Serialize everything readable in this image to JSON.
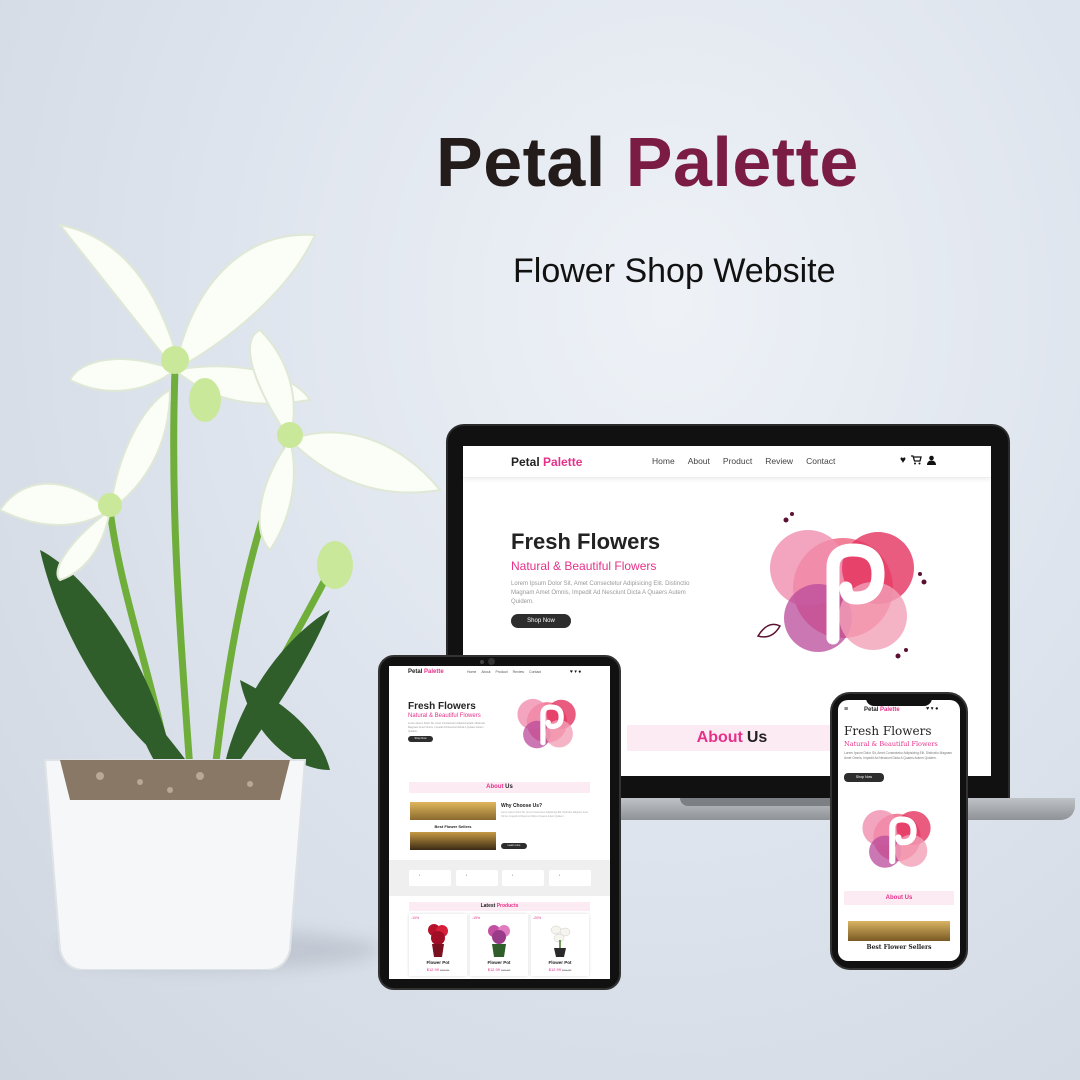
{
  "brand": {
    "name_part1": "Petal",
    "name_part2": "Palette",
    "tagline": "Flower Shop Website"
  },
  "colors": {
    "brand_dark": "#241c1b",
    "brand_accent": "#7a1c44",
    "site_pink": "#e5318a",
    "button_dark": "#2d2d2d"
  },
  "site": {
    "logo_part1": "Petal",
    "logo_part2": "Palette",
    "nav": [
      "Home",
      "About",
      "Product",
      "Review",
      "Contact"
    ],
    "nav_icons": [
      "heart-icon",
      "cart-icon",
      "user-icon"
    ],
    "hero_title": "Fresh Flowers",
    "hero_subtitle": "Natural & Beautiful Flowers",
    "hero_body": "Lorem Ipsum Dolor Sit, Amet Consectetur Adipisicing Elit. Distinctio Magnam Amet Omnis, Impedit Ad Nesciunt Dicta A Quaers Autem Quidem.",
    "cta": "Shop Now",
    "about_part1": "About",
    "about_part2": "Us",
    "why_title": "Why Choose Us?",
    "best_sellers": "Best Flower Sellers",
    "learn_more": "Learn more",
    "latest_part1": "Latest",
    "latest_part2": "Products",
    "products": [
      {
        "discount": "-10%",
        "name": "Flower Pot",
        "price": "$12.99",
        "old_price": "$15.99"
      },
      {
        "discount": "-15%",
        "name": "Flower Pot",
        "price": "$12.99",
        "old_price": "$15.99"
      },
      {
        "discount": "-20%",
        "name": "Flower Pot",
        "price": "$12.99",
        "old_price": "$15.99"
      }
    ]
  }
}
